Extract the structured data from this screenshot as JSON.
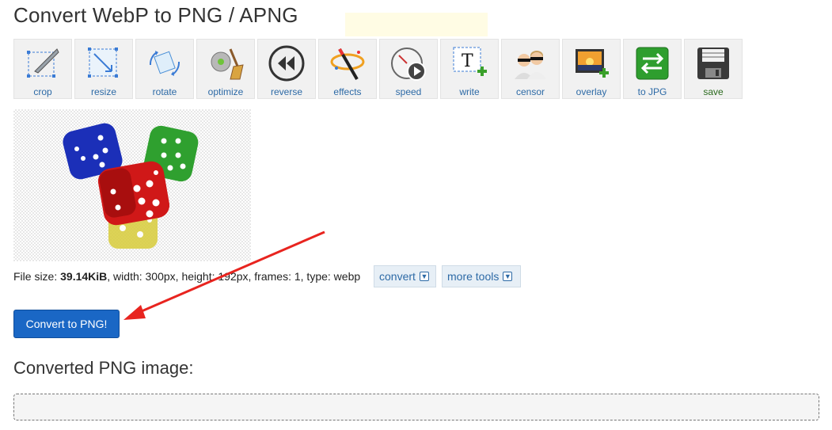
{
  "page": {
    "title": "Convert WebP to PNG / APNG",
    "converted_heading": "Converted PNG image:"
  },
  "toolbar": [
    {
      "label": "crop",
      "icon": "crop-icon"
    },
    {
      "label": "resize",
      "icon": "resize-icon"
    },
    {
      "label": "rotate",
      "icon": "rotate-icon"
    },
    {
      "label": "optimize",
      "icon": "optimize-icon"
    },
    {
      "label": "reverse",
      "icon": "reverse-icon"
    },
    {
      "label": "effects",
      "icon": "effects-icon"
    },
    {
      "label": "speed",
      "icon": "speed-icon"
    },
    {
      "label": "write",
      "icon": "write-icon"
    },
    {
      "label": "censor",
      "icon": "censor-icon"
    },
    {
      "label": "overlay",
      "icon": "overlay-icon"
    },
    {
      "label": "to JPG",
      "icon": "to-jpg-icon"
    },
    {
      "label": "save",
      "icon": "save-icon"
    }
  ],
  "file_info": {
    "size_label": "File size: ",
    "size_value": "39.14KiB",
    "rest": ", width: 300px, height: 192px, frames: 1, type: webp"
  },
  "buttons": {
    "convert_dropdown": "convert",
    "more_tools_dropdown": "more tools",
    "convert_to_png": "Convert to PNG!"
  },
  "colors": {
    "accent_blue": "#1a67c5",
    "link_blue": "#2d6aa6",
    "annotation_red": "#e8241f"
  }
}
